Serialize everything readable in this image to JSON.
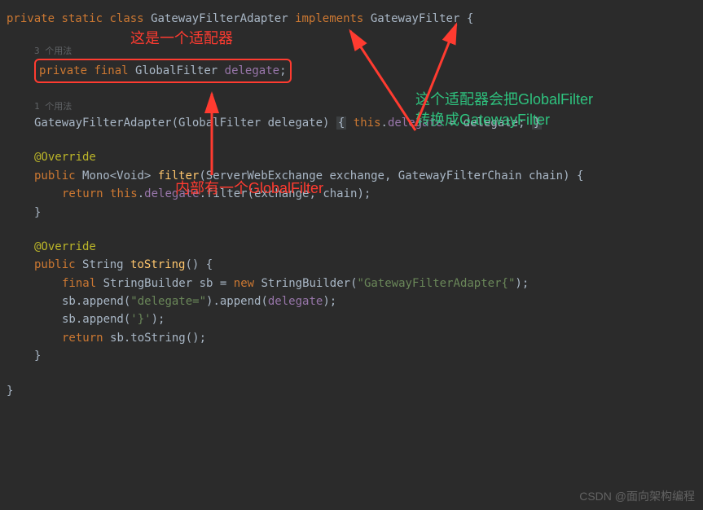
{
  "code": {
    "line1": {
      "private": "private",
      "static": "static",
      "class": "class",
      "className": "GatewayFilterAdapter",
      "implements": "implements",
      "interface": "GatewayFilter",
      "brace": "{"
    },
    "usage1": "3 个用法",
    "line2": {
      "private": "private",
      "final": "final",
      "type": "GlobalFilter",
      "field": "delegate",
      "semi": ";"
    },
    "usage2": "1 个用法",
    "line3": {
      "ctor": "GatewayFilterAdapter",
      "paramType": "GlobalFilter",
      "paramName": "delegate",
      "this": "this",
      "field": "delegate",
      "assign": " = delegate; "
    },
    "override1": "@Override",
    "filter": {
      "public": "public",
      "returnType": "Mono<Void>",
      "name": "filter",
      "param1Type": "ServerWebExchange",
      "param1Name": "exchange",
      "param2Type": "GatewayFilterChain",
      "param2Name": "chain",
      "brace": "{",
      "return": "return",
      "this": "this",
      "field": "delegate",
      "call": ".filter(exchange, chain);",
      "closeBrace": "}"
    },
    "override2": "@Override",
    "toString": {
      "public": "public",
      "returnType": "String",
      "name": "toString",
      "brace": "{",
      "final": "final",
      "sbType": "StringBuilder",
      "sbVar": "sb",
      "new": "new",
      "sbCtor": "StringBuilder",
      "str1": "\"GatewayFilterAdapter{\"",
      "append1a": "sb.append(",
      "str2": "\"delegate=\"",
      "append1b": ").append(",
      "field": "delegate",
      "append1c": ");",
      "append2a": "sb.append(",
      "char1": "'}'",
      "append2b": ");",
      "return": "return",
      "returnExpr": "sb.toString();",
      "closeBrace": "}"
    },
    "finalBrace": "}"
  },
  "annotations": {
    "red1": "这是一个适配器",
    "red2": "内部有一个GlobalFilter",
    "green1": "这个适配器会把GlobalFilter",
    "green2": "转换成GatewayFilter"
  },
  "watermark": "CSDN @面向架构编程"
}
